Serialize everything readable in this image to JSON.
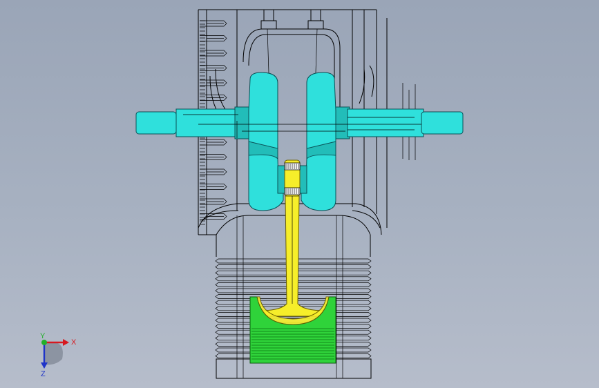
{
  "triad": {
    "x_label": "X",
    "y_label": "Y",
    "z_label": "Z",
    "x_color": "#d71920",
    "y_color": "#23b02a",
    "z_color": "#1f34c8"
  },
  "model": {
    "crankshaft_color": "#2fe0dc",
    "connecting_rod_color": "#f6ee2a",
    "piston_color": "#2fd33a",
    "wireframe_color": "#000000"
  }
}
